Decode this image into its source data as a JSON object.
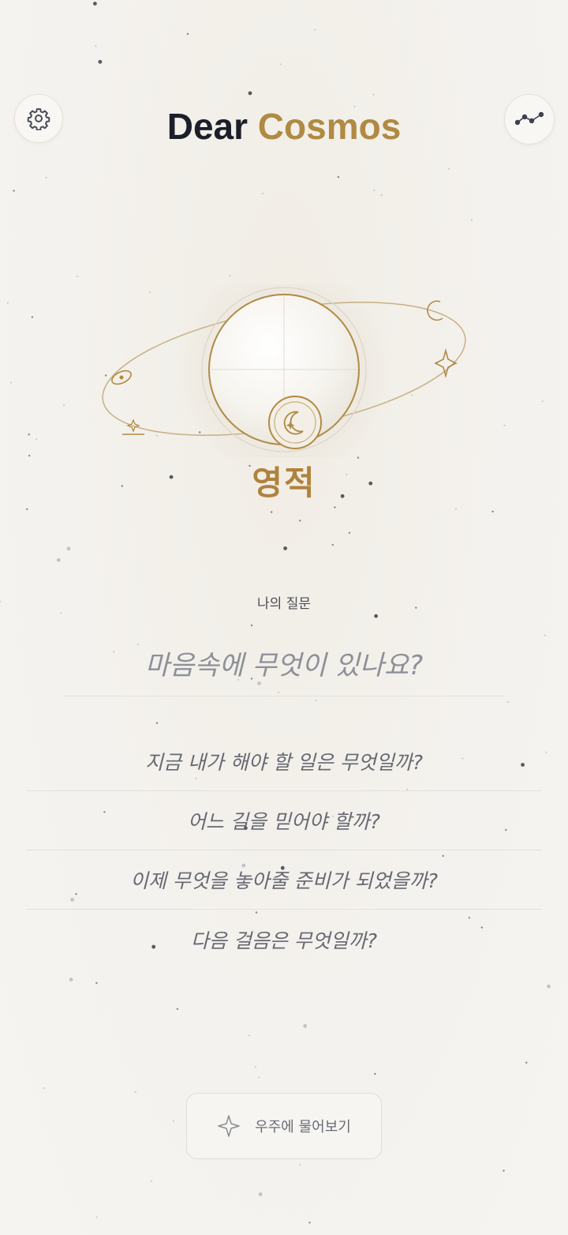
{
  "header": {
    "title_part1": "Dear",
    "title_part2": "Cosmos",
    "settings_icon": "gear-icon",
    "stats_icon": "line-chart-icon"
  },
  "result": {
    "label": "영적"
  },
  "question": {
    "label": "나의 질문",
    "placeholder": "마음속에 무엇이 있나요?"
  },
  "suggestions": [
    "지금 내가 해야 할 일은 무엇일까?",
    "어느 길을 믿어야 할까?",
    "이제 무엇을 놓아줄 준비가 되었을까?",
    "다음 걸음은 무엇일까?"
  ],
  "ask_button": {
    "label": "우주에 물어보기",
    "icon": "sparkle-icon"
  },
  "colors": {
    "accent": "#b08a43",
    "title_dark": "#1c1f2a",
    "background": "#f4f2ee"
  }
}
